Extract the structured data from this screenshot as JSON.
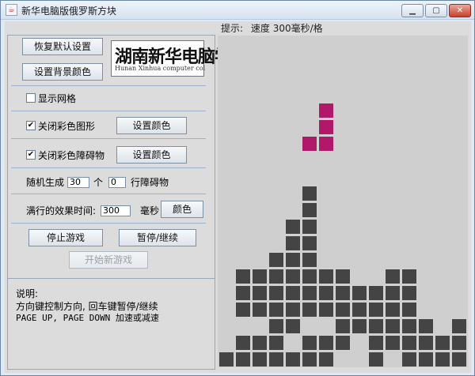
{
  "window": {
    "title": "新华电脑版俄罗斯方块",
    "icon": "java-cup-icon"
  },
  "left": {
    "restore_default_label": "恢复默认设置",
    "set_bg_color_label": "设置背景颜色",
    "logo": {
      "main": "湖南新华电脑学",
      "sub": "Hunan Xinhua computer col"
    },
    "show_grid_label": "显示网格",
    "shape_color": {
      "checkbox_label": "关闭彩色图形",
      "button_label": "设置颜色"
    },
    "obstacle_color": {
      "checkbox_label": "关闭彩色障碍物",
      "button_label": "设置颜色"
    },
    "random": {
      "prefix": "随机生成",
      "count_value": "30",
      "count_unit": "个",
      "rows_value": "0",
      "rows_suffix": "行障碍物"
    },
    "effect": {
      "label": "满行的效果时间:",
      "value": "300",
      "unit": "毫秒",
      "color_button": "颜色"
    },
    "stop_label": "停止游戏",
    "pause_label": "暂停/继续",
    "new_game_label": "开始新游戏"
  },
  "info": {
    "title": "说明:",
    "line1": "方向键控制方向, 回车键暂停/继续",
    "line2": "PAGE UP, PAGE DOWN 加速或减速"
  },
  "hint": {
    "label": "提示:",
    "speed_text": "速度 300毫秒/格"
  },
  "colors": {
    "piece": "#b0186a",
    "block": "#444444",
    "board": "#cfcfcf"
  },
  "falling_piece": [
    [
      6,
      4
    ],
    [
      6,
      5
    ],
    [
      6,
      6
    ],
    [
      5,
      6
    ]
  ],
  "obstacles": [
    [
      5,
      9
    ],
    [
      5,
      10
    ],
    [
      5,
      11
    ],
    [
      5,
      12
    ],
    [
      5,
      13
    ],
    [
      5,
      14
    ],
    [
      5,
      15
    ],
    [
      4,
      11
    ],
    [
      4,
      12
    ],
    [
      4,
      13
    ],
    [
      4,
      14
    ],
    [
      4,
      15
    ],
    [
      4,
      16
    ],
    [
      4,
      17
    ],
    [
      3,
      13
    ],
    [
      3,
      14
    ],
    [
      3,
      15
    ],
    [
      3,
      16
    ],
    [
      3,
      17
    ],
    [
      3,
      18
    ],
    [
      3,
      19
    ],
    [
      1,
      14
    ],
    [
      2,
      14
    ],
    [
      1,
      15
    ],
    [
      2,
      15
    ],
    [
      3,
      15
    ],
    [
      5,
      14
    ],
    [
      6,
      14
    ],
    [
      7,
      14
    ],
    [
      1,
      16
    ],
    [
      2,
      16
    ],
    [
      3,
      16
    ],
    [
      5,
      15
    ],
    [
      6,
      15
    ],
    [
      7,
      15
    ],
    [
      0,
      19
    ],
    [
      1,
      19
    ],
    [
      2,
      19
    ],
    [
      3,
      18
    ],
    [
      5,
      16
    ],
    [
      6,
      16
    ],
    [
      8,
      15
    ],
    [
      9,
      15
    ],
    [
      8,
      16
    ],
    [
      9,
      16
    ],
    [
      10,
      16
    ],
    [
      11,
      16
    ],
    [
      10,
      14
    ],
    [
      11,
      14
    ],
    [
      10,
      15
    ],
    [
      11,
      15
    ],
    [
      7,
      16
    ],
    [
      7,
      17
    ],
    [
      8,
      17
    ],
    [
      9,
      17
    ],
    [
      10,
      17
    ],
    [
      11,
      17
    ],
    [
      12,
      17
    ],
    [
      12,
      18
    ],
    [
      13,
      18
    ],
    [
      14,
      18
    ],
    [
      11,
      18
    ],
    [
      10,
      18
    ],
    [
      9,
      18
    ],
    [
      14,
      17
    ],
    [
      14,
      19
    ],
    [
      13,
      19
    ],
    [
      12,
      19
    ],
    [
      11,
      19
    ],
    [
      9,
      19
    ],
    [
      6,
      19
    ],
    [
      5,
      19
    ],
    [
      4,
      19
    ],
    [
      7,
      18
    ],
    [
      6,
      18
    ],
    [
      5,
      18
    ],
    [
      2,
      18
    ],
    [
      1,
      18
    ]
  ]
}
